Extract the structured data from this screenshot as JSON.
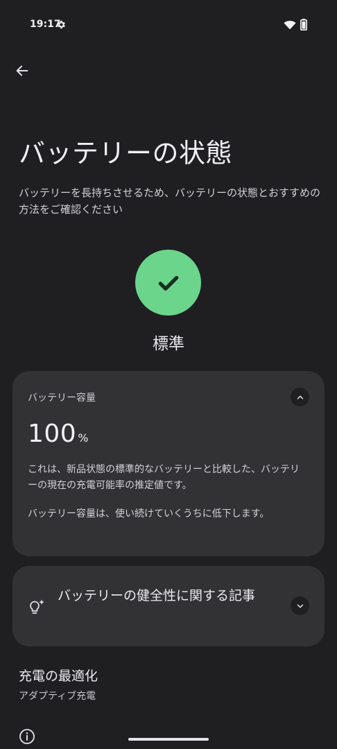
{
  "status_bar": {
    "time": "19:17",
    "icons": [
      "gear-icon",
      "wifi-icon",
      "battery-icon"
    ]
  },
  "header": {
    "back_icon": "arrow-left-icon"
  },
  "page": {
    "title": "バッテリーの状態",
    "description": "バッテリーを長持ちさせるため、バッテリーの状態とおすすめの方法をご確認ください"
  },
  "health_status": {
    "icon": "check-icon",
    "label": "標準",
    "color": "#6bd58c"
  },
  "capacity_card": {
    "title": "バッテリー容量",
    "value": "100",
    "unit": "%",
    "text1": "これは、新品状態の標準的なバッテリーと比較した、バッテリーの現在の充電可能率の推定値です。",
    "text2": "バッテリー容量は、使い続けていくうちに低下します。",
    "toggle_icon": "chevron-up-icon"
  },
  "article_card": {
    "icon": "lightbulb-sparkle-icon",
    "title": "バッテリーの健全性に関する記事",
    "toggle_icon": "chevron-down-icon"
  },
  "charging_optimization": {
    "title": "充電の最適化",
    "subtitle": "アダプティブ充電"
  },
  "footer": {
    "info_icon": "info-icon"
  }
}
